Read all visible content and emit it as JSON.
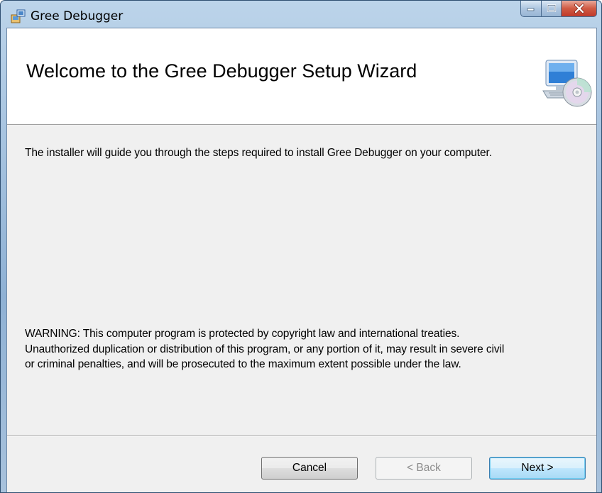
{
  "window": {
    "title": "Gree Debugger",
    "controls": {
      "minimize": "minimize",
      "maximize": "maximize",
      "close": "close"
    }
  },
  "banner": {
    "title": "Welcome to the Gree Debugger Setup Wizard",
    "icon": "computer-cd-icon"
  },
  "body": {
    "intro": "The installer will guide you through the steps required to install Gree Debugger on your computer.",
    "warning_lines": [
      "WARNING: This computer program is protected by copyright law and international treaties.",
      "Unauthorized duplication or distribution of this program, or any portion of it, may result in severe civil",
      "or criminal penalties, and will be prosecuted to the maximum extent possible under the law."
    ]
  },
  "buttons": {
    "cancel": "Cancel",
    "back": "< Back",
    "next": "Next >"
  },
  "colors": {
    "title_bar": "#a8c2dc",
    "banner_bg": "#ffffff",
    "client_bg": "#f0f0f0",
    "close_button": "#c0392b"
  }
}
